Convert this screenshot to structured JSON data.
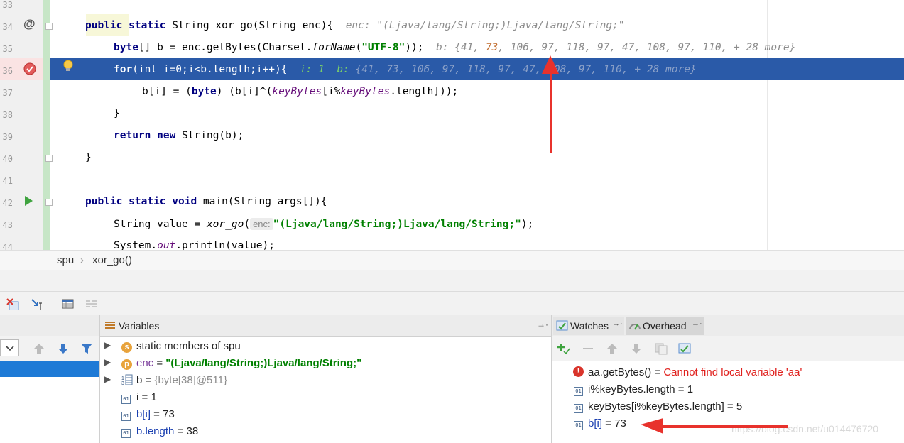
{
  "editor": {
    "line_numbers": [
      "33",
      "34",
      "35",
      "36",
      "37",
      "38",
      "39",
      "40",
      "41",
      "42",
      "43",
      "44"
    ],
    "lines": {
      "l34": {
        "kw1": "public",
        "kw2": "static",
        "rest": " String xor_go(String enc){",
        "hint": "enc: \"(Ljava/lang/String;)Ljava/lang/String;\""
      },
      "l35": {
        "kw": "byte",
        "pre": "[] b = enc.getBytes(Charset.",
        "method": "forName",
        "open": "(",
        "str": "\"UTF-8\"",
        "close": "));",
        "hint_a": "b: {41, ",
        "hint_hl": "73",
        "hint_b": ", 106, 97, 118, 97, 47, 108, 97, 110, + 28 more}"
      },
      "l36": {
        "kw": "for",
        "code": "(int i=0;i<b.length;i++){",
        "hint_i": "i: 1",
        "hint_b_label": "b:",
        "hint_b": "{41, 73, 106, 97, 118, 97, 47, 108, 97, 110, + 28 more}"
      },
      "l37": {
        "pre": "b[i] = (",
        "kw": "byte",
        "mid": ") (b[i]^(",
        "f1": "keyBytes",
        "m2": "[i%",
        "f2": "keyBytes",
        "m3": ".length]));"
      },
      "l38": {
        "code": "}"
      },
      "l39": {
        "kw1": "return",
        "kw2": "new",
        "rest": " String(b);"
      },
      "l40": {
        "code": "}"
      },
      "l42": {
        "kw1": "public",
        "kw2": "static",
        "kw3": "void",
        "rest": " main(String args[]){"
      },
      "l43": {
        "pre": "String value = ",
        "method": "xor_go",
        "open": "(",
        "param_hint": "enc:",
        "str": "\"(Ljava/lang/String;)Ljava/lang/String;\"",
        "close": ");"
      },
      "l44": {
        "pre": "System.",
        "fld": "out",
        "post": ".println(value);"
      }
    }
  },
  "breadcrumb": {
    "class": "spu",
    "method": "xor_go()"
  },
  "variables": {
    "title": "Variables",
    "rows": [
      {
        "badge": "s",
        "label": "static members of spu"
      },
      {
        "badge": "p",
        "name": "enc",
        "eq": " = ",
        "value": "\"(Ljava/lang/String;)Ljava/lang/String;\""
      },
      {
        "name": "b",
        "eq": " = ",
        "value": "{byte[38]@511}"
      },
      {
        "name": "i",
        "eq": " = ",
        "value": "1"
      },
      {
        "name": "b[i]",
        "eq": " = ",
        "value": "73"
      },
      {
        "name": "b.length",
        "eq": " = ",
        "value": "38"
      }
    ]
  },
  "watches": {
    "tab1": "Watches",
    "tab2": "Overhead",
    "rows": [
      {
        "expr": "aa.getBytes()",
        "eq": " = ",
        "value": "Cannot find local variable 'aa'"
      },
      {
        "expr": "i%keyBytes.length",
        "eq": " = ",
        "value": "1"
      },
      {
        "expr": "keyBytes[i%keyBytes.length]",
        "eq": " = ",
        "value": "5"
      },
      {
        "expr": "b[i]",
        "eq": " = ",
        "value": "73"
      }
    ]
  },
  "watermark": "https://blog.csdn.net/u014476720",
  "colors": {
    "execution_line": "#2a5aa8",
    "annotation_arrow": "#e8322c",
    "error_text": "#e0201d",
    "string": "#008000"
  },
  "icons": [
    "at-sign-icon",
    "breakpoint-check-icon",
    "bulb-icon",
    "run-arrow-icon",
    "clear-icon",
    "step-icon",
    "table-icon",
    "list-icon",
    "up-arrow-icon",
    "down-arrow-icon",
    "filter-icon",
    "add-watch-icon",
    "remove-icon",
    "error-icon"
  ]
}
